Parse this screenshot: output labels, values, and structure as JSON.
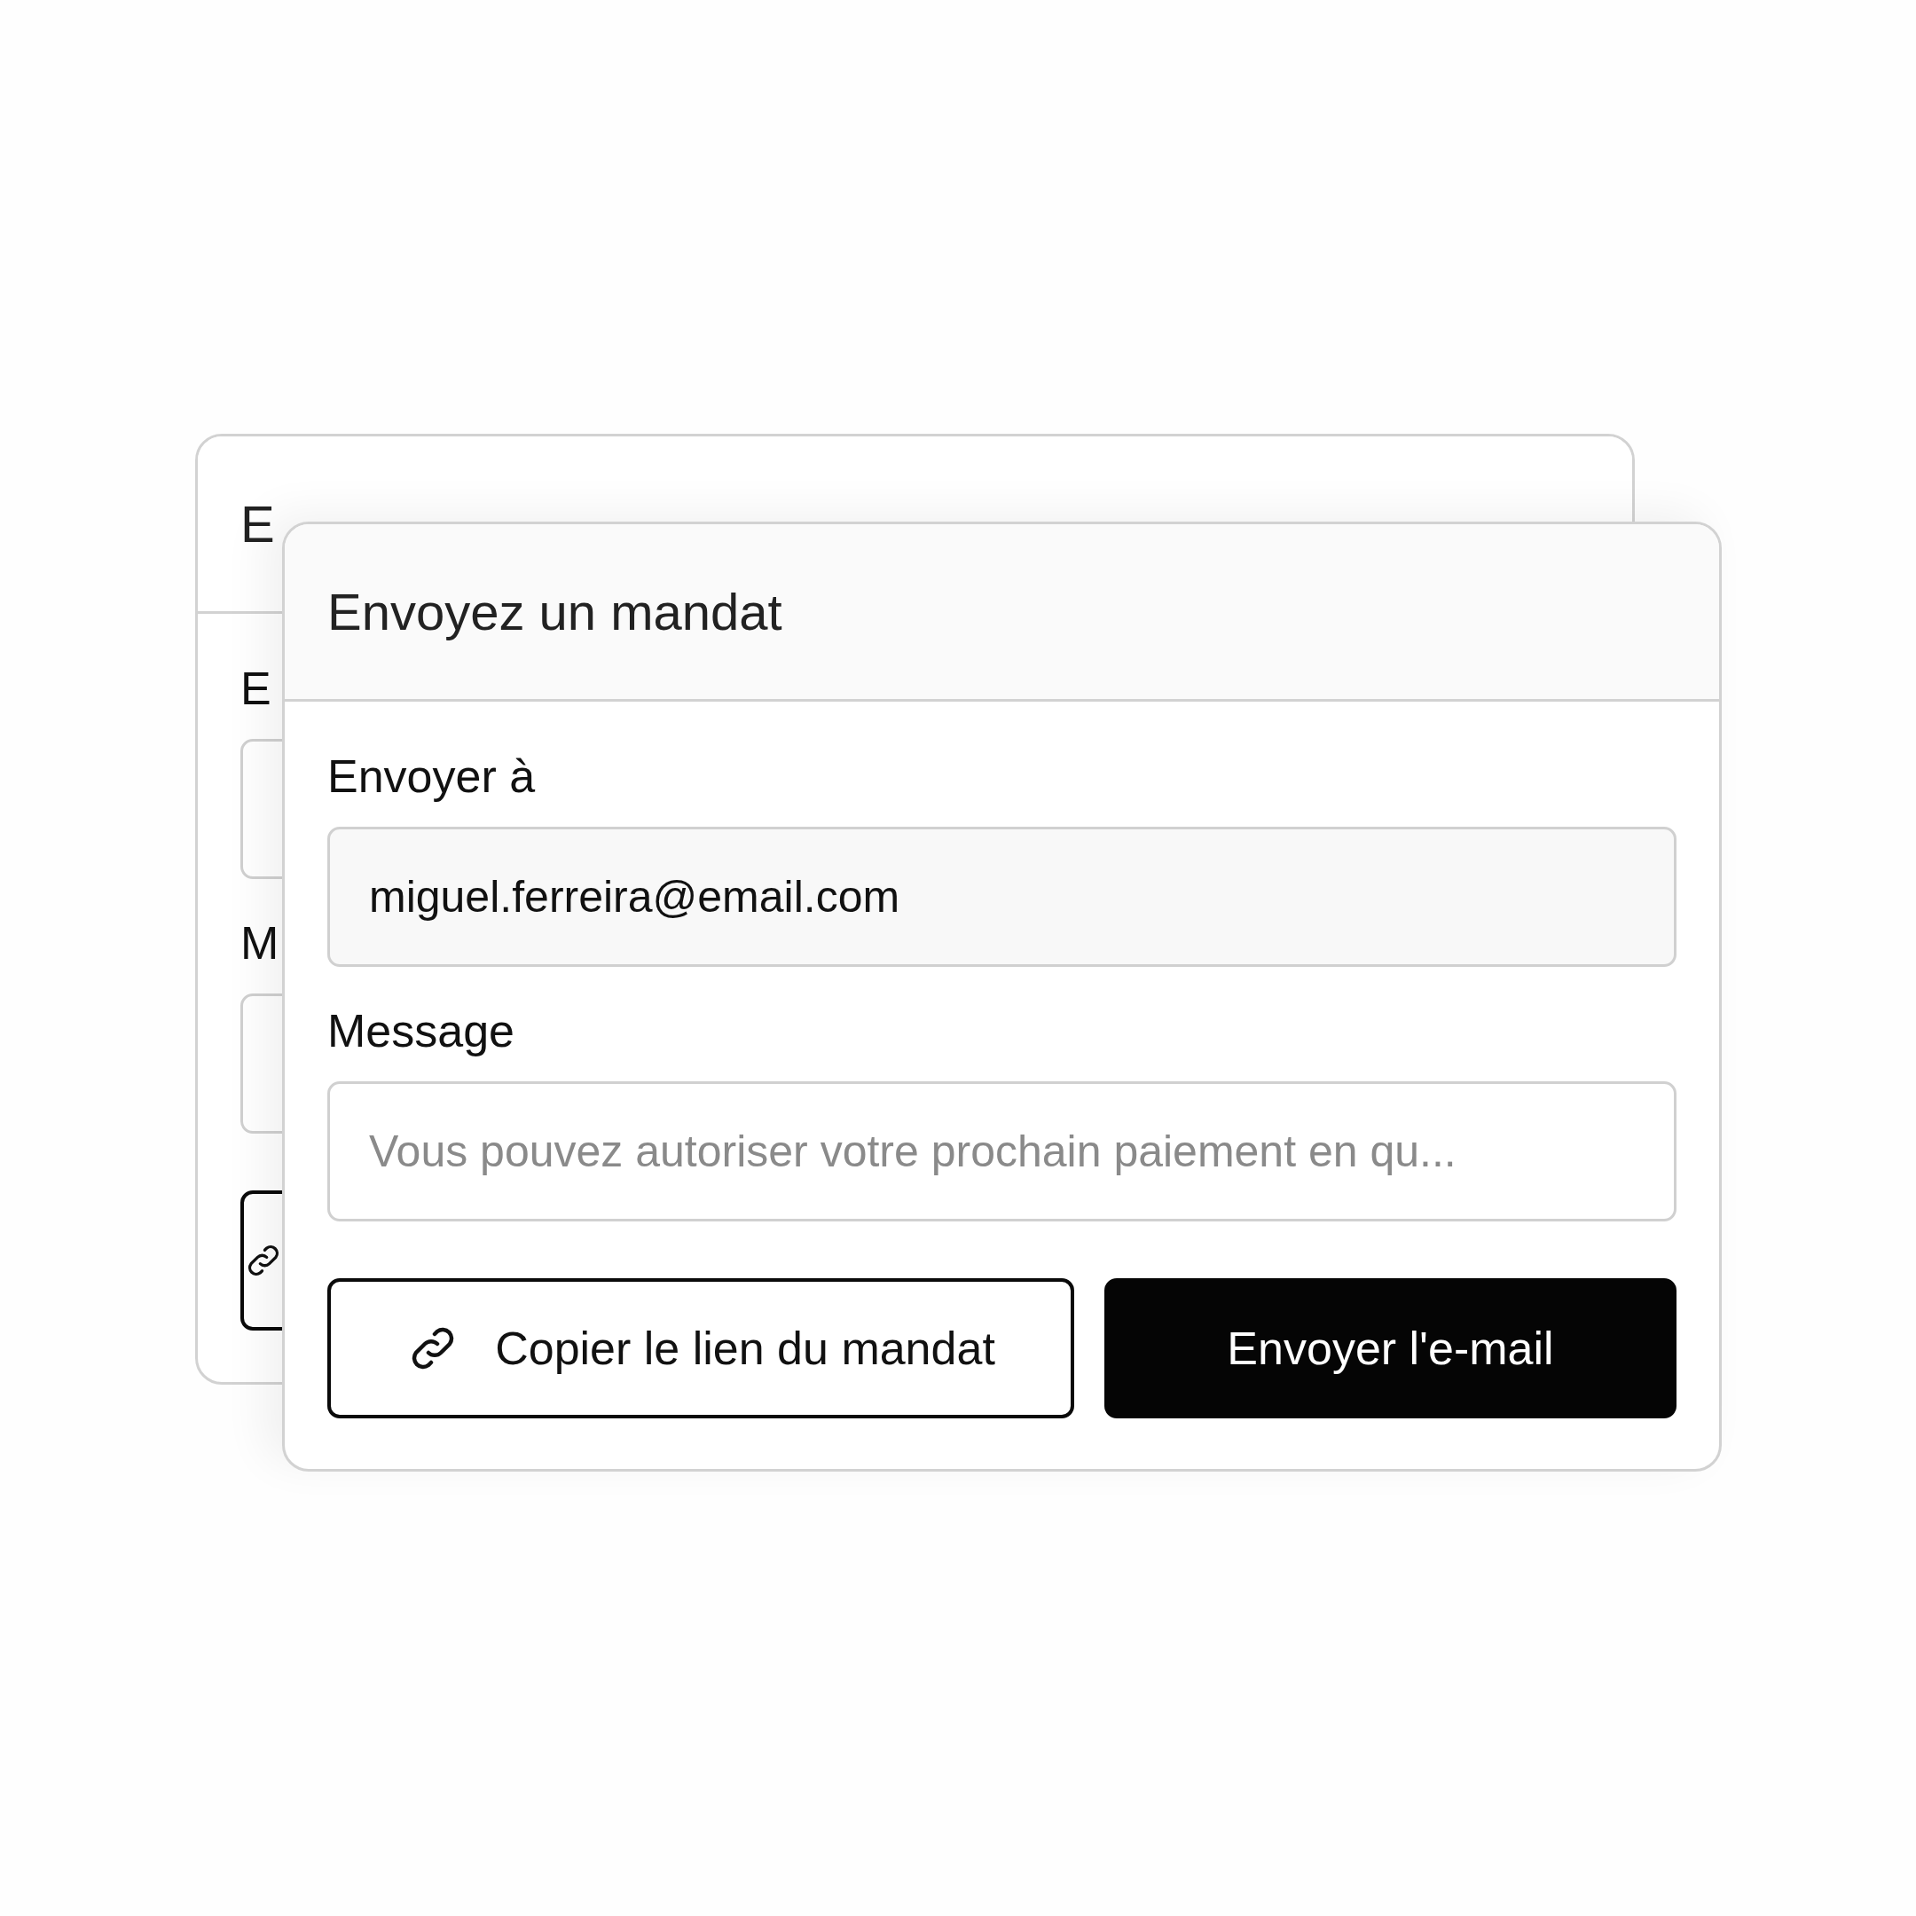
{
  "background_dialog": {
    "title": "E",
    "fields": [
      {
        "label": "E"
      },
      {
        "label": "M"
      }
    ],
    "buttons": [
      {
        "kind": "secondary"
      }
    ]
  },
  "dialog": {
    "title": "Envoyez un mandat",
    "fields": [
      {
        "label": "Envoyer à",
        "value": "miguel.ferreira@email.com"
      },
      {
        "label": "Message",
        "placeholder": "Vous pouvez autoriser votre prochain paiement en qu..."
      }
    ],
    "buttons": [
      {
        "label": "Copier le lien du mandat",
        "kind": "secondary"
      },
      {
        "label": "Envoyer l'e-mail",
        "kind": "primary"
      }
    ]
  }
}
